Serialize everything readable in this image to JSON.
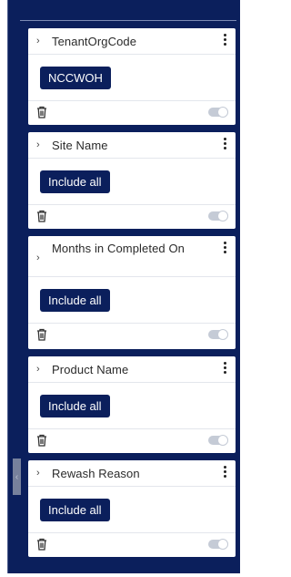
{
  "filters": [
    {
      "title": "TenantOrgCode",
      "value": "NCCWOH"
    },
    {
      "title": "Site Name",
      "value": "Include all"
    },
    {
      "title": "Months in Completed On",
      "value": "Include all"
    },
    {
      "title": "Product Name",
      "value": "Include all"
    },
    {
      "title": "Rewash Reason",
      "value": "Include all"
    }
  ],
  "icons": {
    "expand": "chevron-right-icon",
    "menu": "kebab-menu-icon",
    "delete": "trash-icon",
    "toggle": "toggle-switch"
  },
  "colors": {
    "panel": "#0b1f5c",
    "chip": "#0b1f5c",
    "toggle_track": "#c5cbd6"
  }
}
